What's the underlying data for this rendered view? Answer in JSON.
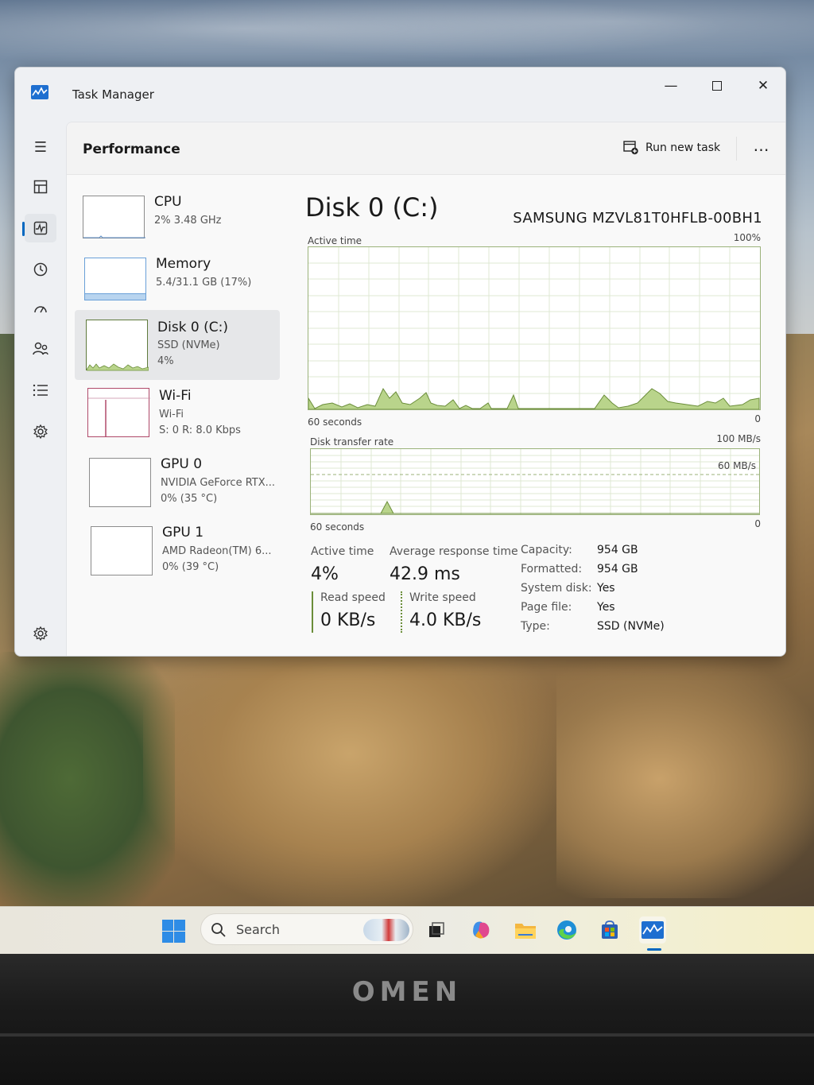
{
  "window": {
    "title": "Task Manager"
  },
  "header": {
    "title": "Performance",
    "run_new_task": "Run new task",
    "more": "…"
  },
  "devices": [
    {
      "name": "CPU",
      "line1": "2%  3.48 GHz",
      "line2": ""
    },
    {
      "name": "Memory",
      "line1": "5.4/31.1 GB (17%)",
      "line2": ""
    },
    {
      "name": "Disk 0 (C:)",
      "line1": "SSD (NVMe)",
      "line2": "4%"
    },
    {
      "name": "Wi-Fi",
      "line1": "Wi-Fi",
      "line2": "S: 0  R: 8.0 Kbps"
    },
    {
      "name": "GPU 0",
      "line1": "NVIDIA GeForce RTX...",
      "line2": "0%  (35 °C)"
    },
    {
      "name": "GPU 1",
      "line1": "AMD Radeon(TM) 6...",
      "line2": "0%  (39 °C)"
    }
  ],
  "main": {
    "title": "Disk 0 (C:)",
    "model": "SAMSUNG MZVL81T0HFLB-00BH1",
    "active_chart": {
      "label": "Active time",
      "max": "100%",
      "time": "60 seconds",
      "min": "0"
    },
    "transfer_chart": {
      "label": "Disk transfer rate",
      "max": "100 MB/s",
      "mid": "60 MB/s",
      "time": "60 seconds",
      "min": "0"
    },
    "stats": {
      "active_time_label": "Active time",
      "active_time_value": "4%",
      "avg_response_label": "Average response time",
      "avg_response_value": "42.9 ms",
      "read_speed_label": "Read speed",
      "read_speed_value": "0 KB/s",
      "write_speed_label": "Write speed",
      "write_speed_value": "4.0 KB/s"
    },
    "properties": [
      {
        "label": "Capacity:",
        "value": "954 GB"
      },
      {
        "label": "Formatted:",
        "value": "954 GB"
      },
      {
        "label": "System disk:",
        "value": "Yes"
      },
      {
        "label": "Page file:",
        "value": "Yes"
      },
      {
        "label": "Type:",
        "value": "SSD (NVMe)"
      }
    ]
  },
  "taskbar": {
    "search_placeholder": "Search"
  },
  "bezel": {
    "brand": "OMEN"
  },
  "colors": {
    "disk_green": "#6b8e3a",
    "disk_fill": "#b9d48b",
    "memory_blue": "#6aa0d8",
    "wifi_red": "#b04a6a",
    "accent": "#0067c0"
  }
}
